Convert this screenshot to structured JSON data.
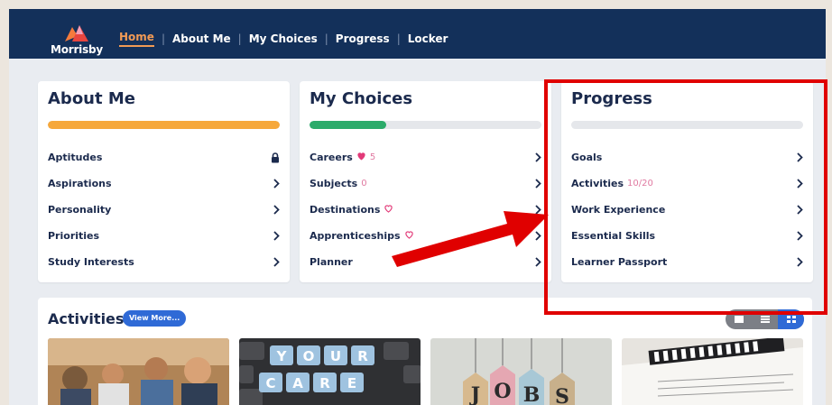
{
  "nav": {
    "logo_text": "Morrisby",
    "links": [
      "Home",
      "About Me",
      "My Choices",
      "Progress",
      "Locker"
    ]
  },
  "about_me": {
    "title": "About Me",
    "progress": 1.0,
    "bar_color": "#f6a83b",
    "items": [
      {
        "label": "Aptitudes",
        "icon": "lock-icon"
      },
      {
        "label": "Aspirations",
        "icon": "chevron-right-icon"
      },
      {
        "label": "Personality",
        "icon": "chevron-right-icon"
      },
      {
        "label": "Priorities",
        "icon": "chevron-right-icon"
      },
      {
        "label": "Study Interests",
        "icon": "chevron-right-icon"
      }
    ]
  },
  "my_choices": {
    "title": "My Choices",
    "progress": 0.33,
    "bar_color": "#2bab6a",
    "items": [
      {
        "label": "Careers",
        "badge": "5",
        "heart": "filled"
      },
      {
        "label": "Subjects",
        "badge": "0"
      },
      {
        "label": "Destinations",
        "heart": "outline"
      },
      {
        "label": "Apprenticeships",
        "heart": "outline"
      },
      {
        "label": "Planner"
      }
    ]
  },
  "progress": {
    "title": "Progress",
    "progress": 0.0,
    "items": [
      {
        "label": "Goals"
      },
      {
        "label": "Activities",
        "badge": "10/20"
      },
      {
        "label": "Work Experience"
      },
      {
        "label": "Essential Skills"
      },
      {
        "label": "Learner Passport"
      }
    ]
  },
  "activities": {
    "title": "Activities",
    "view_more": "View More...",
    "thumbnails": [
      {
        "name": "students-classroom"
      },
      {
        "name": "keyboard-your-career",
        "text": "YOUR CARE"
      },
      {
        "name": "jobs-tags",
        "text": "JOBS"
      },
      {
        "name": "curriculum-vitae"
      }
    ]
  },
  "colors": {
    "nav_bg": "#13305a",
    "accent_orange": "#f19a55",
    "highlight_red": "#e00000",
    "primary_blue": "#2f6ad6"
  }
}
